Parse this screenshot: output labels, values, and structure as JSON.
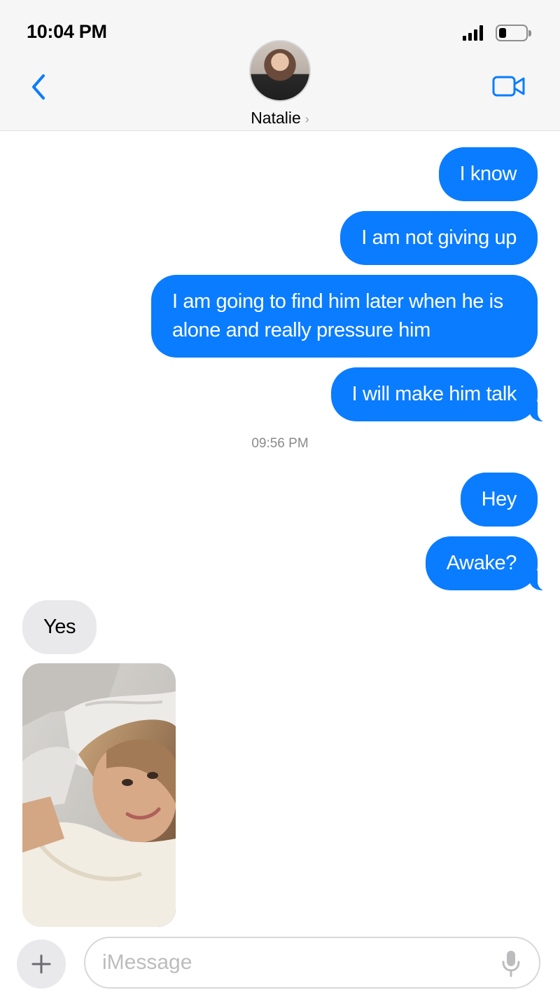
{
  "status_bar": {
    "time": "10:04 PM",
    "signal_icon": "cellular-signal-icon",
    "battery_icon": "battery-low-icon"
  },
  "header": {
    "back_icon": "chevron-left-icon",
    "video_icon": "video-camera-icon",
    "contact_name": "Natalie",
    "contact_chevron": "›"
  },
  "conversation": {
    "outgoing_group_1": [
      "I know",
      "I am not giving up",
      "I am going to find him later when he is alone and really pressure him",
      "I will make him talk"
    ],
    "timestamp": "09:56 PM",
    "outgoing_group_2": [
      "Hey",
      "Awake?"
    ],
    "incoming": [
      "Yes"
    ],
    "incoming_photo": "selfie-photo"
  },
  "composer": {
    "plus_label": "+",
    "placeholder": "iMessage",
    "mic_icon": "microphone-icon"
  },
  "colors": {
    "outgoing_bubble": "#0a7cff",
    "incoming_bubble": "#e9e9eb",
    "accent": "#0a7cff"
  }
}
